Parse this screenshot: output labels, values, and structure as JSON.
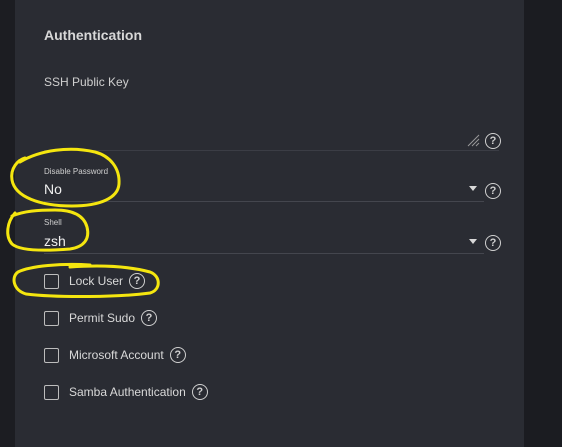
{
  "section": {
    "title": "Authentication"
  },
  "ssh": {
    "label": "SSH Public Key",
    "value": ""
  },
  "disable_password": {
    "label": "Disable Password",
    "value": "No"
  },
  "shell": {
    "label": "Shell",
    "value": "zsh"
  },
  "checkboxes": [
    {
      "label": "Lock User",
      "checked": false
    },
    {
      "label": "Permit Sudo",
      "checked": false
    },
    {
      "label": "Microsoft Account",
      "checked": false
    },
    {
      "label": "Samba Authentication",
      "checked": false
    }
  ],
  "icons": {
    "help": "help-circle-icon",
    "caret": "caret-down-icon",
    "resize": "resize-handle-icon"
  },
  "help_glyph": "?",
  "colors": {
    "background": "#2a2c33",
    "annotation": "#f5e60f",
    "text": "#e3e3e3"
  }
}
